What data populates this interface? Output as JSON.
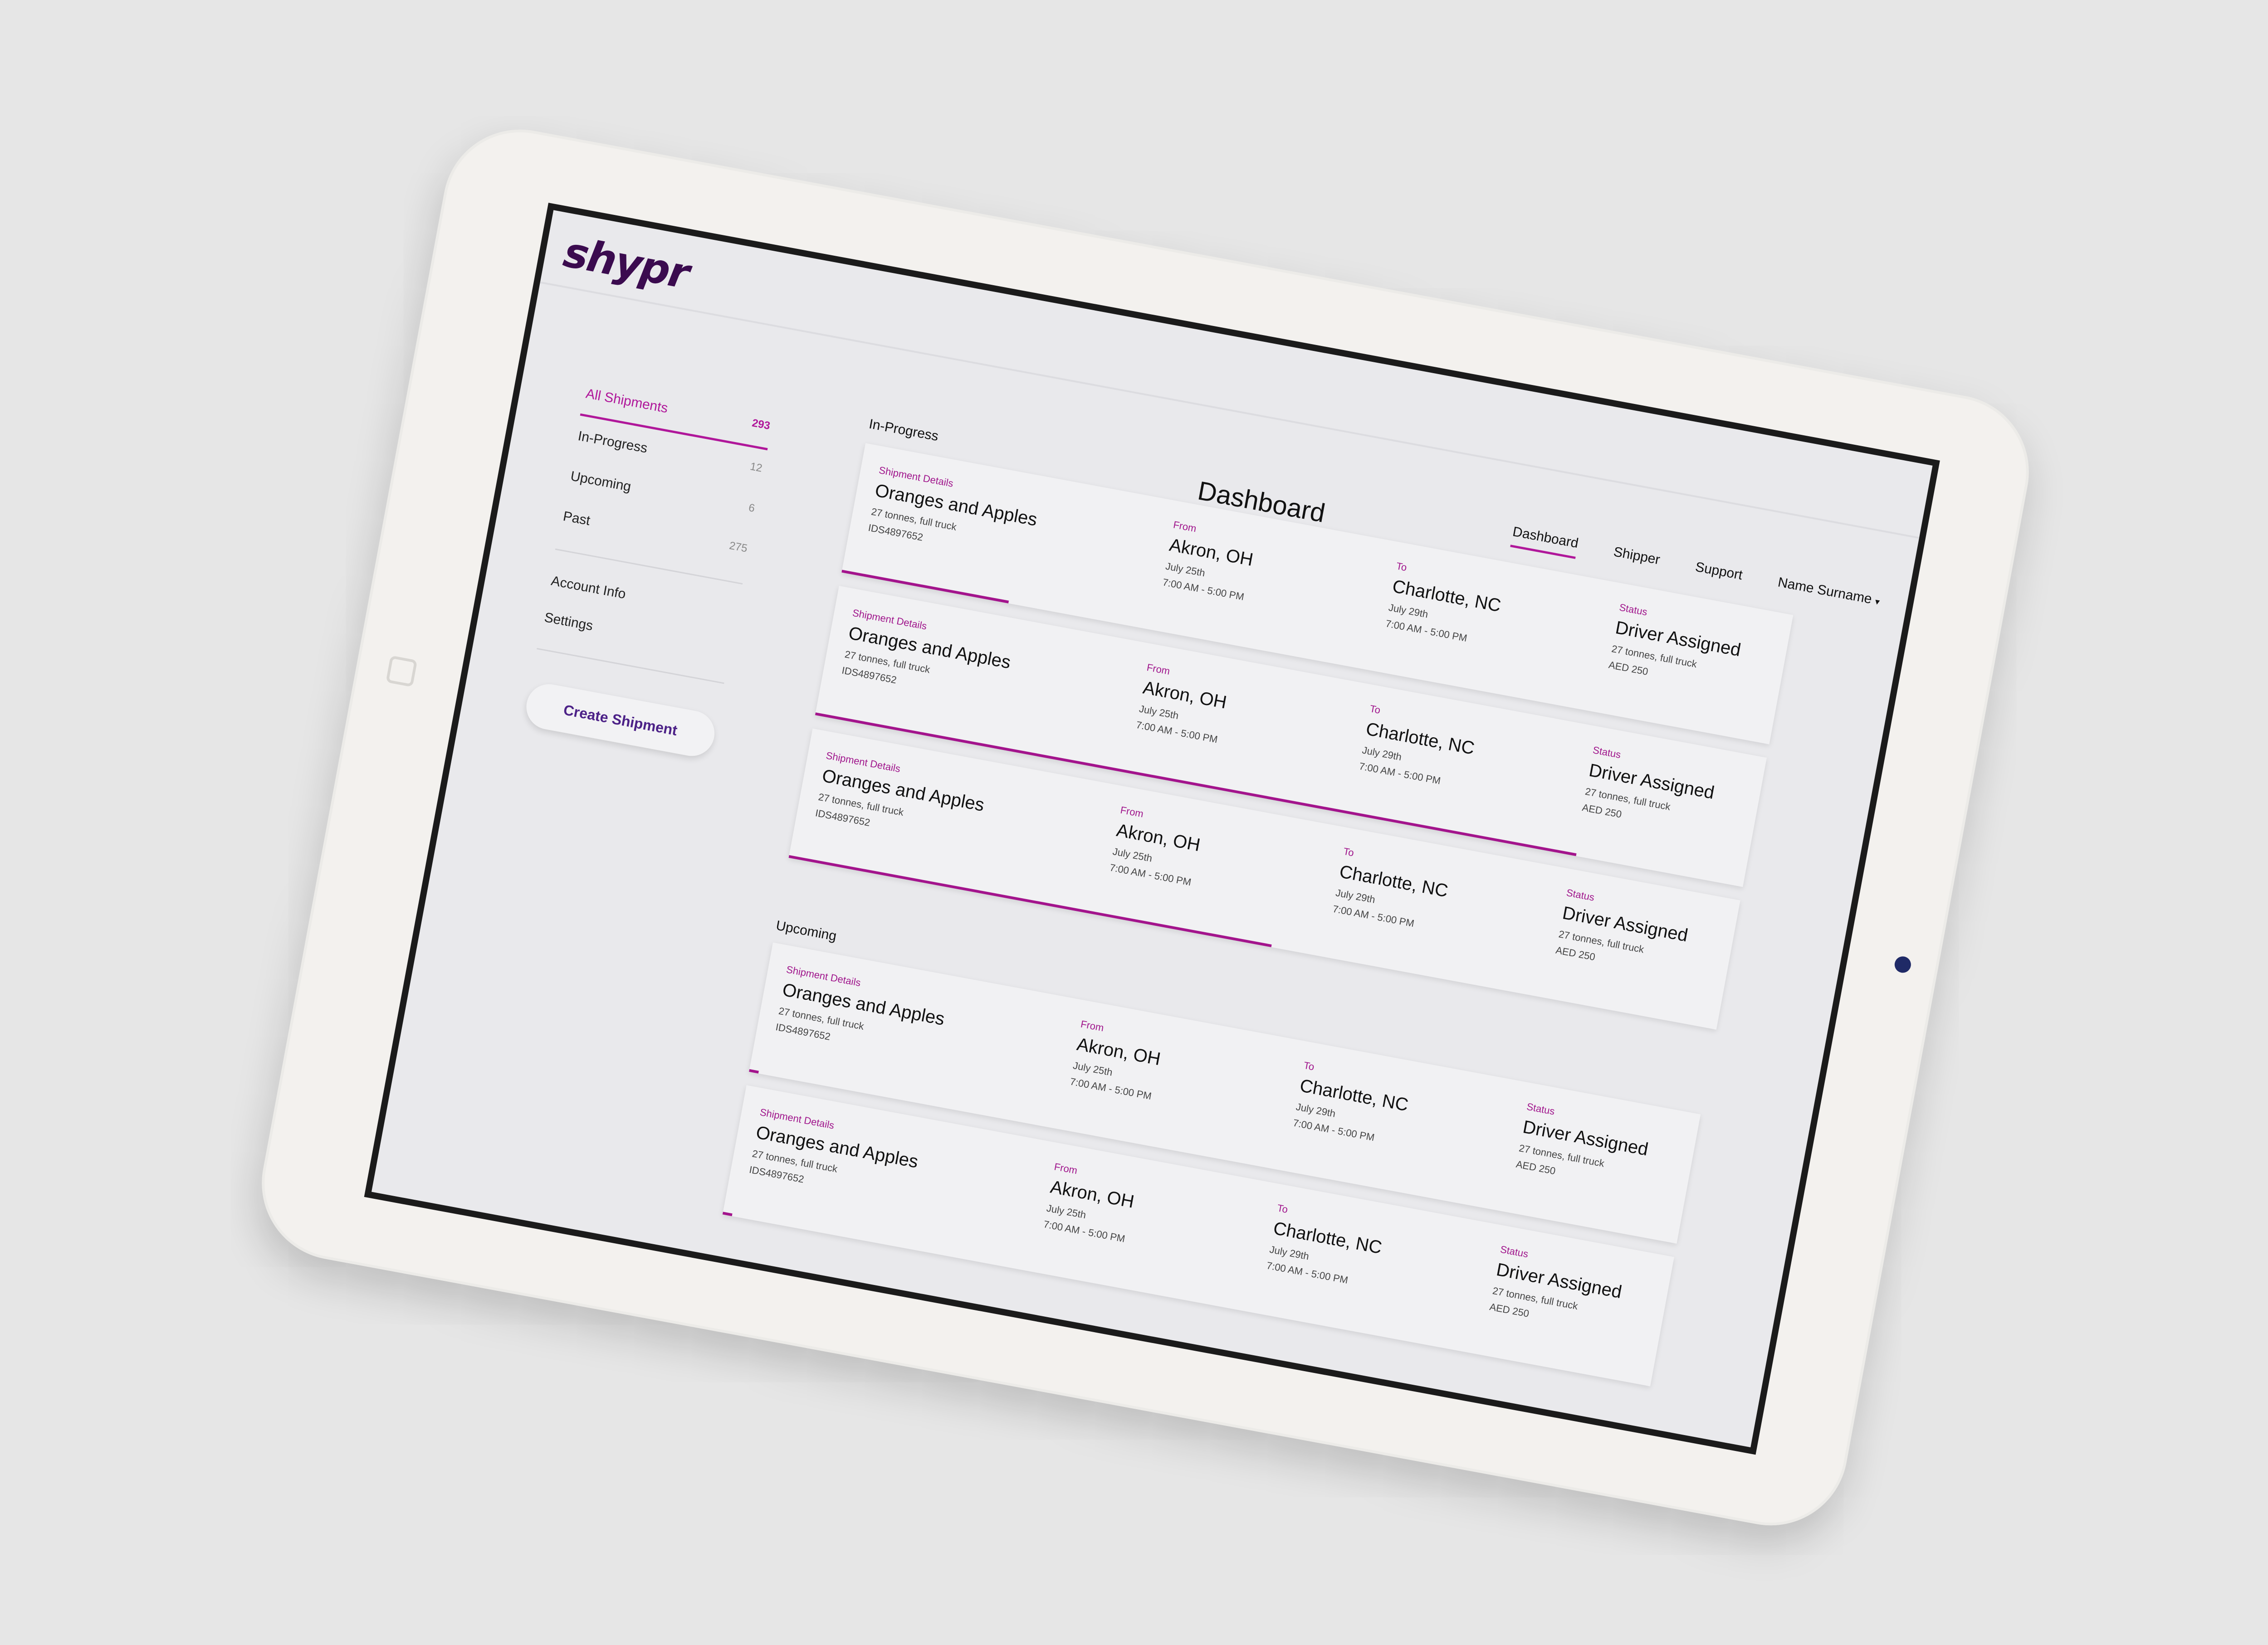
{
  "brand": {
    "logo": "shypr"
  },
  "nav": [
    {
      "label": "Dashboard",
      "active": true
    },
    {
      "label": "Shipper",
      "active": false
    },
    {
      "label": "Support",
      "active": false
    }
  ],
  "user": {
    "name": "Name Surname"
  },
  "page": {
    "title": "Dashboard"
  },
  "sidebar": {
    "items": [
      {
        "label": "All Shipments",
        "count": "293",
        "active": true
      },
      {
        "label": "In-Progress",
        "count": "12",
        "active": false
      },
      {
        "label": "Upcoming",
        "count": "6",
        "active": false
      },
      {
        "label": "Past",
        "count": "275",
        "active": false
      }
    ],
    "links": [
      {
        "label": "Account Info"
      },
      {
        "label": "Settings"
      }
    ],
    "create_button": "Create Shipment"
  },
  "sections": {
    "in_progress": "In-Progress",
    "upcoming": "Upcoming"
  },
  "shipments": [
    {
      "details_label": "Shipment Details",
      "name": "Oranges and Apples",
      "load": "27 tonnes, full truck",
      "id": "IDS4897652",
      "from_label": "From",
      "from": "Akron, OH",
      "from_date": "July 25th",
      "from_time": "7:00 AM - 5:00 PM",
      "to_label": "To",
      "to": "Charlotte, NC",
      "to_date": "July 29th",
      "to_time": "7:00 AM - 5:00 PM",
      "status_label": "Status",
      "status": "Driver Assigned",
      "status_load": "27 tonnes, full truck",
      "price": "AED 250",
      "progress": 0.18
    },
    {
      "details_label": "Shipment Details",
      "name": "Oranges and Apples",
      "load": "27 tonnes, full truck",
      "id": "IDS4897652",
      "from_label": "From",
      "from": "Akron, OH",
      "from_date": "July 25th",
      "from_time": "7:00 AM - 5:00 PM",
      "to_label": "To",
      "to": "Charlotte, NC",
      "to_date": "July 29th",
      "to_time": "7:00 AM - 5:00 PM",
      "status_label": "Status",
      "status": "Driver Assigned",
      "status_load": "27 tonnes, full truck",
      "price": "AED 250",
      "progress": 0.82
    },
    {
      "details_label": "Shipment Details",
      "name": "Oranges and Apples",
      "load": "27 tonnes, full truck",
      "id": "IDS4897652",
      "from_label": "From",
      "from": "Akron, OH",
      "from_date": "July 25th",
      "from_time": "7:00 AM - 5:00 PM",
      "to_label": "To",
      "to": "Charlotte, NC",
      "to_date": "July 29th",
      "to_time": "7:00 AM - 5:00 PM",
      "status_label": "Status",
      "status": "Driver Assigned",
      "status_load": "27 tonnes, full truck",
      "price": "AED 250",
      "progress": 0.52
    },
    {
      "details_label": "Shipment Details",
      "name": "Oranges and Apples",
      "load": "27 tonnes, full truck",
      "id": "IDS4897652",
      "from_label": "From",
      "from": "Akron, OH",
      "from_date": "July 25th",
      "from_time": "7:00 AM - 5:00 PM",
      "to_label": "To",
      "to": "Charlotte, NC",
      "to_date": "July 29th",
      "to_time": "7:00 AM - 5:00 PM",
      "status_label": "Status",
      "status": "Driver Assigned",
      "status_load": "27 tonnes, full truck",
      "price": "AED 250",
      "progress": 0.01
    },
    {
      "details_label": "Shipment Details",
      "name": "Oranges and Apples",
      "load": "27 tonnes, full truck",
      "id": "IDS4897652",
      "from_label": "From",
      "from": "Akron, OH",
      "from_date": "July 25th",
      "from_time": "7:00 AM - 5:00 PM",
      "to_label": "To",
      "to": "Charlotte, NC",
      "to_date": "July 29th",
      "to_time": "7:00 AM - 5:00 PM",
      "status_label": "Status",
      "status": "Driver Assigned",
      "status_load": "27 tonnes, full truck",
      "price": "AED 250",
      "progress": 0.01
    }
  ]
}
